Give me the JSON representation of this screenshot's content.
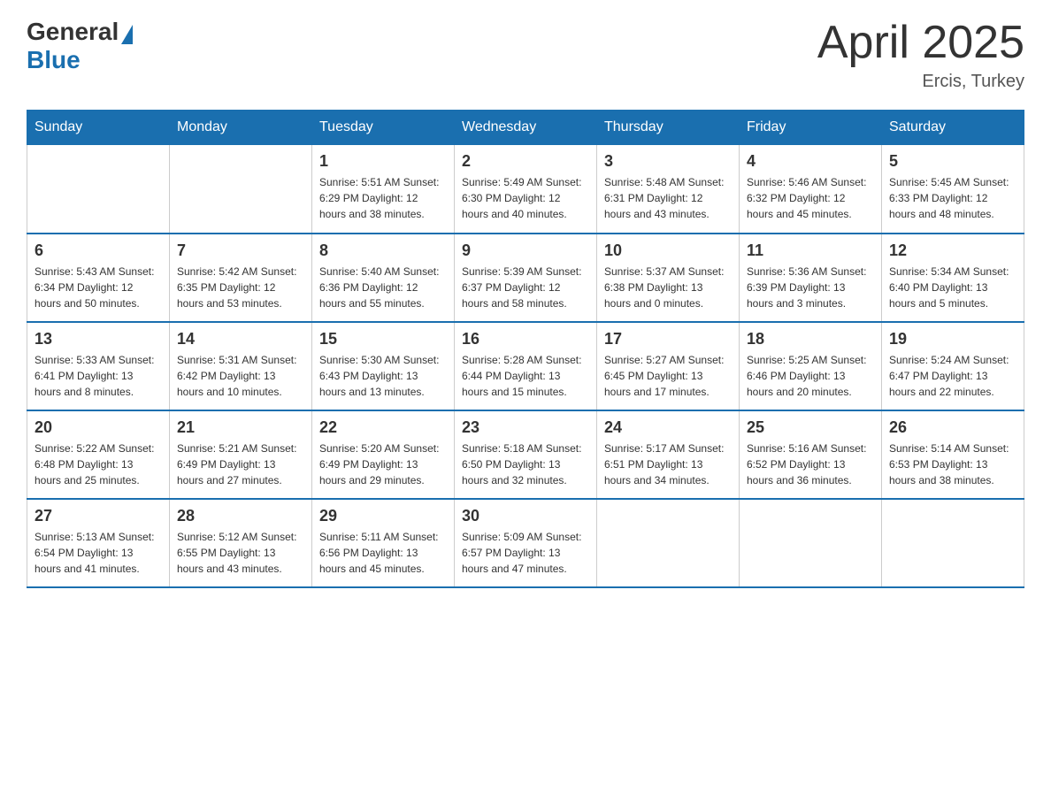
{
  "logo": {
    "text_general": "General",
    "text_blue": "Blue",
    "tagline": ""
  },
  "header": {
    "title": "April 2025",
    "subtitle": "Ercis, Turkey"
  },
  "weekdays": [
    "Sunday",
    "Monday",
    "Tuesday",
    "Wednesday",
    "Thursday",
    "Friday",
    "Saturday"
  ],
  "weeks": [
    [
      {
        "day": "",
        "info": ""
      },
      {
        "day": "",
        "info": ""
      },
      {
        "day": "1",
        "info": "Sunrise: 5:51 AM\nSunset: 6:29 PM\nDaylight: 12 hours\nand 38 minutes."
      },
      {
        "day": "2",
        "info": "Sunrise: 5:49 AM\nSunset: 6:30 PM\nDaylight: 12 hours\nand 40 minutes."
      },
      {
        "day": "3",
        "info": "Sunrise: 5:48 AM\nSunset: 6:31 PM\nDaylight: 12 hours\nand 43 minutes."
      },
      {
        "day": "4",
        "info": "Sunrise: 5:46 AM\nSunset: 6:32 PM\nDaylight: 12 hours\nand 45 minutes."
      },
      {
        "day": "5",
        "info": "Sunrise: 5:45 AM\nSunset: 6:33 PM\nDaylight: 12 hours\nand 48 minutes."
      }
    ],
    [
      {
        "day": "6",
        "info": "Sunrise: 5:43 AM\nSunset: 6:34 PM\nDaylight: 12 hours\nand 50 minutes."
      },
      {
        "day": "7",
        "info": "Sunrise: 5:42 AM\nSunset: 6:35 PM\nDaylight: 12 hours\nand 53 minutes."
      },
      {
        "day": "8",
        "info": "Sunrise: 5:40 AM\nSunset: 6:36 PM\nDaylight: 12 hours\nand 55 minutes."
      },
      {
        "day": "9",
        "info": "Sunrise: 5:39 AM\nSunset: 6:37 PM\nDaylight: 12 hours\nand 58 minutes."
      },
      {
        "day": "10",
        "info": "Sunrise: 5:37 AM\nSunset: 6:38 PM\nDaylight: 13 hours\nand 0 minutes."
      },
      {
        "day": "11",
        "info": "Sunrise: 5:36 AM\nSunset: 6:39 PM\nDaylight: 13 hours\nand 3 minutes."
      },
      {
        "day": "12",
        "info": "Sunrise: 5:34 AM\nSunset: 6:40 PM\nDaylight: 13 hours\nand 5 minutes."
      }
    ],
    [
      {
        "day": "13",
        "info": "Sunrise: 5:33 AM\nSunset: 6:41 PM\nDaylight: 13 hours\nand 8 minutes."
      },
      {
        "day": "14",
        "info": "Sunrise: 5:31 AM\nSunset: 6:42 PM\nDaylight: 13 hours\nand 10 minutes."
      },
      {
        "day": "15",
        "info": "Sunrise: 5:30 AM\nSunset: 6:43 PM\nDaylight: 13 hours\nand 13 minutes."
      },
      {
        "day": "16",
        "info": "Sunrise: 5:28 AM\nSunset: 6:44 PM\nDaylight: 13 hours\nand 15 minutes."
      },
      {
        "day": "17",
        "info": "Sunrise: 5:27 AM\nSunset: 6:45 PM\nDaylight: 13 hours\nand 17 minutes."
      },
      {
        "day": "18",
        "info": "Sunrise: 5:25 AM\nSunset: 6:46 PM\nDaylight: 13 hours\nand 20 minutes."
      },
      {
        "day": "19",
        "info": "Sunrise: 5:24 AM\nSunset: 6:47 PM\nDaylight: 13 hours\nand 22 minutes."
      }
    ],
    [
      {
        "day": "20",
        "info": "Sunrise: 5:22 AM\nSunset: 6:48 PM\nDaylight: 13 hours\nand 25 minutes."
      },
      {
        "day": "21",
        "info": "Sunrise: 5:21 AM\nSunset: 6:49 PM\nDaylight: 13 hours\nand 27 minutes."
      },
      {
        "day": "22",
        "info": "Sunrise: 5:20 AM\nSunset: 6:49 PM\nDaylight: 13 hours\nand 29 minutes."
      },
      {
        "day": "23",
        "info": "Sunrise: 5:18 AM\nSunset: 6:50 PM\nDaylight: 13 hours\nand 32 minutes."
      },
      {
        "day": "24",
        "info": "Sunrise: 5:17 AM\nSunset: 6:51 PM\nDaylight: 13 hours\nand 34 minutes."
      },
      {
        "day": "25",
        "info": "Sunrise: 5:16 AM\nSunset: 6:52 PM\nDaylight: 13 hours\nand 36 minutes."
      },
      {
        "day": "26",
        "info": "Sunrise: 5:14 AM\nSunset: 6:53 PM\nDaylight: 13 hours\nand 38 minutes."
      }
    ],
    [
      {
        "day": "27",
        "info": "Sunrise: 5:13 AM\nSunset: 6:54 PM\nDaylight: 13 hours\nand 41 minutes."
      },
      {
        "day": "28",
        "info": "Sunrise: 5:12 AM\nSunset: 6:55 PM\nDaylight: 13 hours\nand 43 minutes."
      },
      {
        "day": "29",
        "info": "Sunrise: 5:11 AM\nSunset: 6:56 PM\nDaylight: 13 hours\nand 45 minutes."
      },
      {
        "day": "30",
        "info": "Sunrise: 5:09 AM\nSunset: 6:57 PM\nDaylight: 13 hours\nand 47 minutes."
      },
      {
        "day": "",
        "info": ""
      },
      {
        "day": "",
        "info": ""
      },
      {
        "day": "",
        "info": ""
      }
    ]
  ]
}
